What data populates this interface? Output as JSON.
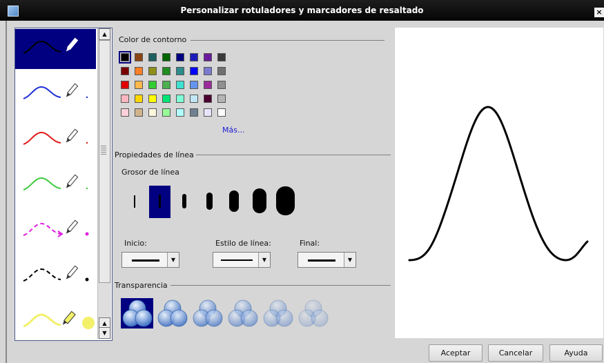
{
  "window": {
    "title": "Personalizar rotuladores y marcadores de resaltado"
  },
  "pens": [
    {
      "kind": "pen",
      "color": "#000000",
      "style": "solid",
      "selected": true
    },
    {
      "kind": "pen",
      "color": "#1f2fd6",
      "style": "solid",
      "selected": false
    },
    {
      "kind": "pen",
      "color": "#e21a1a",
      "style": "solid",
      "selected": false
    },
    {
      "kind": "pen",
      "color": "#3ecb3e",
      "style": "solid",
      "selected": false
    },
    {
      "kind": "pen",
      "color": "#e020e0",
      "style": "dashed-arrow",
      "selected": false
    },
    {
      "kind": "pen",
      "color": "#000000",
      "style": "dashed",
      "selected": false
    },
    {
      "kind": "highlighter",
      "color": "#f3f06a",
      "style": "solid",
      "selected": false
    }
  ],
  "color_section": {
    "title": "Color de contorno",
    "more_link": "Más...",
    "selected_index": 0,
    "swatches": [
      "#000000",
      "#8b4513",
      "#1f5f5f",
      "#006400",
      "#000080",
      "#1c1cb8",
      "#6a1b9a",
      "#3a3a3a",
      "#7a0000",
      "#ff7f27",
      "#8f8f1a",
      "#228b22",
      "#2e8b8b",
      "#0000ff",
      "#7b7bd0",
      "#707070",
      "#e00000",
      "#ffb84d",
      "#33cc33",
      "#4caf50",
      "#40e0d0",
      "#6495ed",
      "#9c2b9c",
      "#909090",
      "#ffb6c1",
      "#ffd700",
      "#ffff00",
      "#00e676",
      "#7fffd4",
      "#c1e7f5",
      "#4b0030",
      "#b5b5b5",
      "#ffd1d9",
      "#d2b48c",
      "#fff8dc",
      "#98fb98",
      "#b0ffff",
      "#708090",
      "#e6e6fa",
      "#ffffff"
    ]
  },
  "line_section": {
    "title": "Propiedades de línea",
    "thickness_label": "Grosor de línea",
    "selected_thickness_index": 1,
    "start_label": "Inicio:",
    "style_label": "Estilo de línea:",
    "end_label": "Final:"
  },
  "transparency_section": {
    "title": "Transparencia",
    "selected_index": 0,
    "levels": [
      1.0,
      0.85,
      0.7,
      0.55,
      0.4,
      0.25
    ]
  },
  "buttons": {
    "ok": "Aceptar",
    "cancel": "Cancelar",
    "help": "Ayuda"
  },
  "icons": {
    "close": "close-icon",
    "scroll_up": "scroll-up-icon",
    "scroll_down": "scroll-down-icon",
    "pen": "pen-icon",
    "dropdown": "chevron-down-icon"
  }
}
